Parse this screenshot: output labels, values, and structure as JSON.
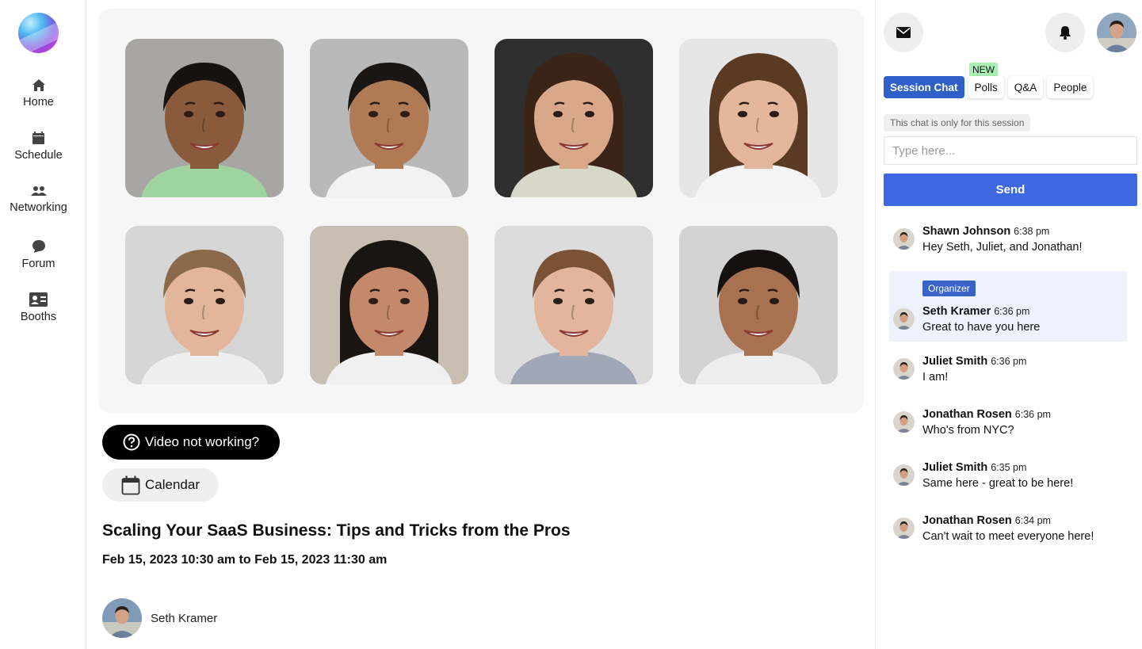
{
  "nav": {
    "items": [
      {
        "label": "Home",
        "icon": "home-icon"
      },
      {
        "label": "Schedule",
        "icon": "calendar-icon"
      },
      {
        "label": "Networking",
        "icon": "people-icon"
      },
      {
        "label": "Forum",
        "icon": "chat-bubble-icon"
      },
      {
        "label": "Booths",
        "icon": "id-card-icon"
      }
    ]
  },
  "video_grid": {
    "tiles": [
      {
        "participant": "participant-1",
        "skin": "#8a5a3c",
        "hair": "#161210",
        "bg": "#a7a6a3",
        "shirt": "#9fd39f"
      },
      {
        "participant": "participant-2",
        "skin": "#b07a55",
        "hair": "#1a1614",
        "bg": "#b9b9b9",
        "shirt": "#f2f2f2"
      },
      {
        "participant": "participant-3",
        "skin": "#d9a88a",
        "hair": "#3a2418",
        "bg": "#2f2f2f",
        "shirt": "#d8d8c8"
      },
      {
        "participant": "participant-4",
        "skin": "#e4b79c",
        "hair": "#5b3a24",
        "bg": "#e6e6e6",
        "shirt": "#f4f4f4"
      },
      {
        "participant": "participant-5",
        "skin": "#e3b59a",
        "hair": "#8a6a4a",
        "bg": "#d6d6d6",
        "shirt": "#efefef"
      },
      {
        "participant": "participant-6",
        "skin": "#c4896a",
        "hair": "#1b1512",
        "bg": "#c8bfb2",
        "shirt": "#f0f0f0"
      },
      {
        "participant": "participant-7",
        "skin": "#e2b59c",
        "hair": "#7a5236",
        "bg": "#dcdcdc",
        "shirt": "#a0a8b8"
      },
      {
        "participant": "participant-8",
        "skin": "#a8714f",
        "hair": "#141110",
        "bg": "#d3d3d3",
        "shirt": "#eeeeee"
      }
    ]
  },
  "actions": {
    "video_help_label": "Video not working?",
    "calendar_label": "Calendar"
  },
  "session": {
    "title": "Scaling Your SaaS Business: Tips and Tricks from the Pros",
    "date_range": "Feb 15, 2023 10:30 am to Feb 15, 2023 11:30 am",
    "speaker_name": "Seth Kramer"
  },
  "chat": {
    "tabs": [
      {
        "label": "Session Chat",
        "active": true
      },
      {
        "label": "Polls",
        "active": false
      },
      {
        "label": "Q&A",
        "active": false
      },
      {
        "label": "People",
        "active": false
      }
    ],
    "new_badge": "NEW",
    "note": "This chat is only for this session",
    "input_placeholder": "Type here...",
    "send_label": "Send",
    "messages": [
      {
        "name": "Shawn Johnson",
        "time": "6:38 pm",
        "text": "Hey Seth, Juliet, and Jonathan!",
        "badge": ""
      },
      {
        "name": "Seth Kramer",
        "time": "6:36 pm",
        "text": "Great to have you here",
        "badge": "Organizer"
      },
      {
        "name": "Juliet Smith",
        "time": "6:36 pm",
        "text": "I am!",
        "badge": ""
      },
      {
        "name": "Jonathan Rosen",
        "time": "6:36 pm",
        "text": "Who's from NYC?",
        "badge": ""
      },
      {
        "name": "Juliet Smith",
        "time": "6:35 pm",
        "text": "Same here - great to be here!",
        "badge": ""
      },
      {
        "name": "Jonathan Rosen",
        "time": "6:34 pm",
        "text": "Can't wait to meet everyone here!",
        "badge": ""
      }
    ]
  },
  "colors": {
    "accent": "#3d68e2",
    "tab_active": "#2f5fc8",
    "new_badge": "#a9efb4",
    "highlight_row": "#edf2fc"
  }
}
